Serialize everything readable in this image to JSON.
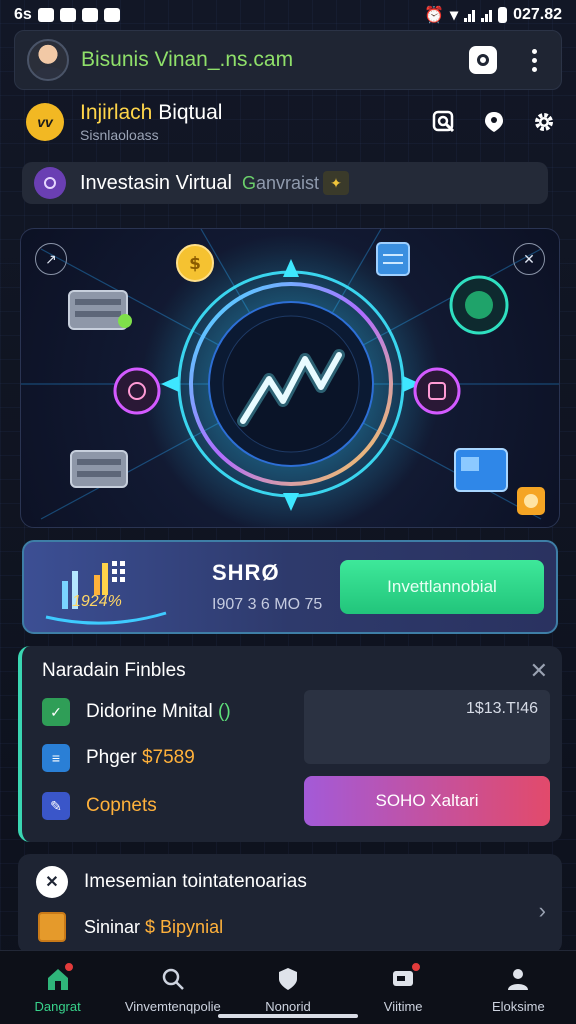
{
  "status_bar": {
    "left_label": "6s",
    "time": "027.82"
  },
  "app_bar": {
    "title": "Bisunis Vinan_.ns.cam"
  },
  "profile": {
    "badge": "vv",
    "name_highlight": "Injirlach",
    "name_rest": " Biqtual",
    "subtitle": "Sisnlaoloass"
  },
  "search": {
    "text": "Investasin Virtual",
    "extra_green": "G",
    "extra_rest": "anvraist"
  },
  "stats": {
    "percent": "1924%",
    "code": "SHRØ",
    "subtext": "I907 3 6 МО 75",
    "invest_button": "Invettlannobial"
  },
  "panel": {
    "title": "Naradain Finbles",
    "items": [
      {
        "label": "Didorine Mnital",
        "suffix": "()"
      },
      {
        "label": "Phger ",
        "amount": "$7589"
      },
      {
        "label": "Copnets"
      }
    ],
    "value": "1$13.T!46",
    "action_button": "SOHO Xaltari"
  },
  "bottom_card": {
    "title": "Imesemian tointatenoarias",
    "sub_label": "Sininar ",
    "sub_highlight": "$ Bipynial"
  },
  "tabs": [
    {
      "label": "Dangrat",
      "icon": "home-icon",
      "active": true
    },
    {
      "label": "Vinvemtenqpolie",
      "icon": "search-icon",
      "active": false
    },
    {
      "label": "Nonorid",
      "icon": "shield-icon",
      "active": false
    },
    {
      "label": "Viitime",
      "icon": "chat-icon",
      "active": false
    },
    {
      "label": "Eloksime",
      "icon": "profile-icon",
      "active": false
    }
  ],
  "colors": {
    "accent_green": "#38d38b",
    "brand_yellow": "#f2b823",
    "panel_border": "#3ad6b2",
    "badge_red": "#e23b3b"
  }
}
